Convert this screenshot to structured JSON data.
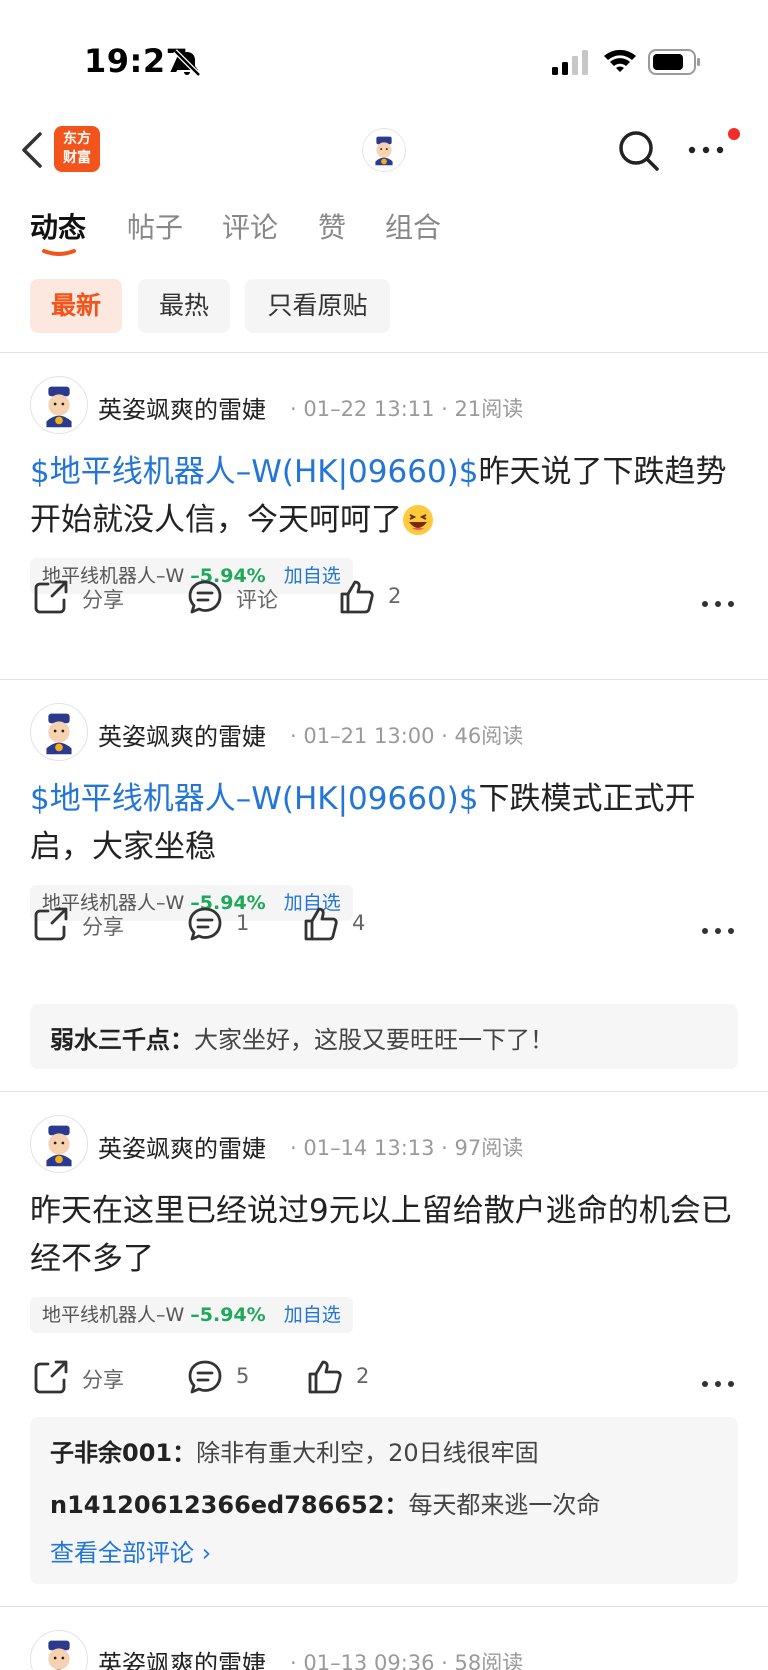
{
  "status_bar": {
    "time": "19:27",
    "icons": [
      "bell-off-icon",
      "signal-icon",
      "wifi-icon",
      "battery-icon"
    ]
  },
  "nav": {
    "logo_line1": "东方",
    "logo_line2": "财富",
    "icons": [
      "back-icon",
      "avatar",
      "search-icon",
      "more-icon"
    ]
  },
  "tabs": [
    "动态",
    "帖子",
    "评论",
    "赞",
    "组合"
  ],
  "filters": [
    "最新",
    "最热",
    "只看原贴"
  ],
  "colors": {
    "accent": "#f2541b",
    "link": "#2376d6",
    "down_green": "#1fa85a",
    "badge_red": "#f32b2b"
  },
  "posts": [
    {
      "author": "英姿飒爽的雷婕",
      "meta": "· 01–22 13:11 · 21阅读",
      "stock_link": "$地平线机器人–W(HK|09660)$",
      "text": "昨天说了下跌趋势开始就没人信，今天呵呵了",
      "chip": {
        "name": "地平线机器人–W",
        "change": "–5.94%",
        "add": "加自选"
      },
      "share": "分享",
      "comment": "评论",
      "likes": "2"
    },
    {
      "author": "英姿飒爽的雷婕",
      "meta": "· 01–21 13:00 · 46阅读",
      "stock_link": "$地平线机器人–W(HK|09660)$",
      "text": "下跌模式正式开启，大家坐稳",
      "chip": {
        "name": "地平线机器人–W",
        "change": "–5.94%",
        "add": "加自选"
      },
      "share": "分享",
      "comment": "1",
      "likes": "4",
      "comments": [
        {
          "user": "弱水三千点：",
          "text": "大家坐好，这股又要旺旺一下了！"
        }
      ]
    },
    {
      "author": "英姿飒爽的雷婕",
      "meta": "· 01–14 13:13 · 97阅读",
      "stock_link": "",
      "text": "昨天在这里已经说过9元以上留给散户逃命的机会已经不多了",
      "chip": {
        "name": "地平线机器人–W",
        "change": "–5.94%",
        "add": "加自选"
      },
      "share": "分享",
      "comment": "5",
      "likes": "2",
      "comments": [
        {
          "user": "子非余001：",
          "text": "除非有重大利空，20日线很牢固"
        },
        {
          "user": "n14120612366ed786652：",
          "text": "每天都来逃一次命"
        }
      ],
      "view_all": "查看全部评论 ›"
    },
    {
      "author": "英姿飒爽的雷婕",
      "meta": "· 01–13 09:36 · 58阅读"
    }
  ]
}
